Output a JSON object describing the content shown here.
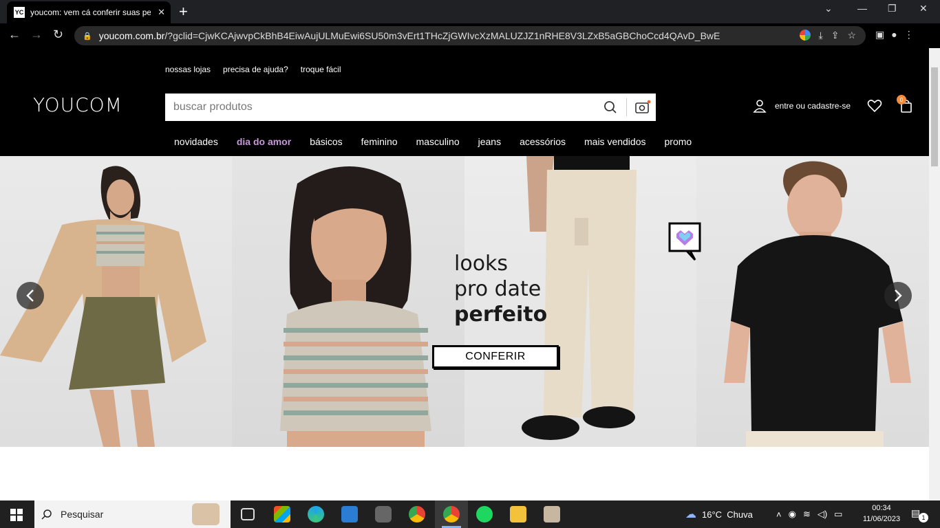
{
  "browser": {
    "tab_title": "youcom: vem cá conferir suas pe",
    "tab_favicon": "YC",
    "url_host": "youcom.com.br",
    "url_path": "/?gclid=CjwKCAjwvpCkBhB4EiwAujULMuEwi6SU50m3vErt1THcZjGWIvcXzMALUZJZ1nRHE8V3LZxB5aGBChoCcd4QAvD_BwE"
  },
  "site": {
    "logo": "YOUCOM",
    "topnav": [
      "nossas lojas",
      "precisa de ajuda?",
      "troque fácil"
    ],
    "search_placeholder": "buscar produtos",
    "account_label": "entre ou cadastre-se",
    "cart_count": "0",
    "categories": [
      "novidades",
      "dia do amor",
      "básicos",
      "feminino",
      "masculino",
      "jeans",
      "acessórios",
      "mais vendidos",
      "promo"
    ],
    "highlight_color": "#c69ad9"
  },
  "hero": {
    "headline_line1": "looks",
    "headline_line2": "pro date",
    "headline_line3": "perfeito",
    "cta_label": "CONFERIR"
  },
  "taskbar": {
    "search_label": "Pesquisar",
    "weather": "16°C  Chuva",
    "time": "00:34",
    "date": "11/06/2023",
    "notifications": "1"
  }
}
